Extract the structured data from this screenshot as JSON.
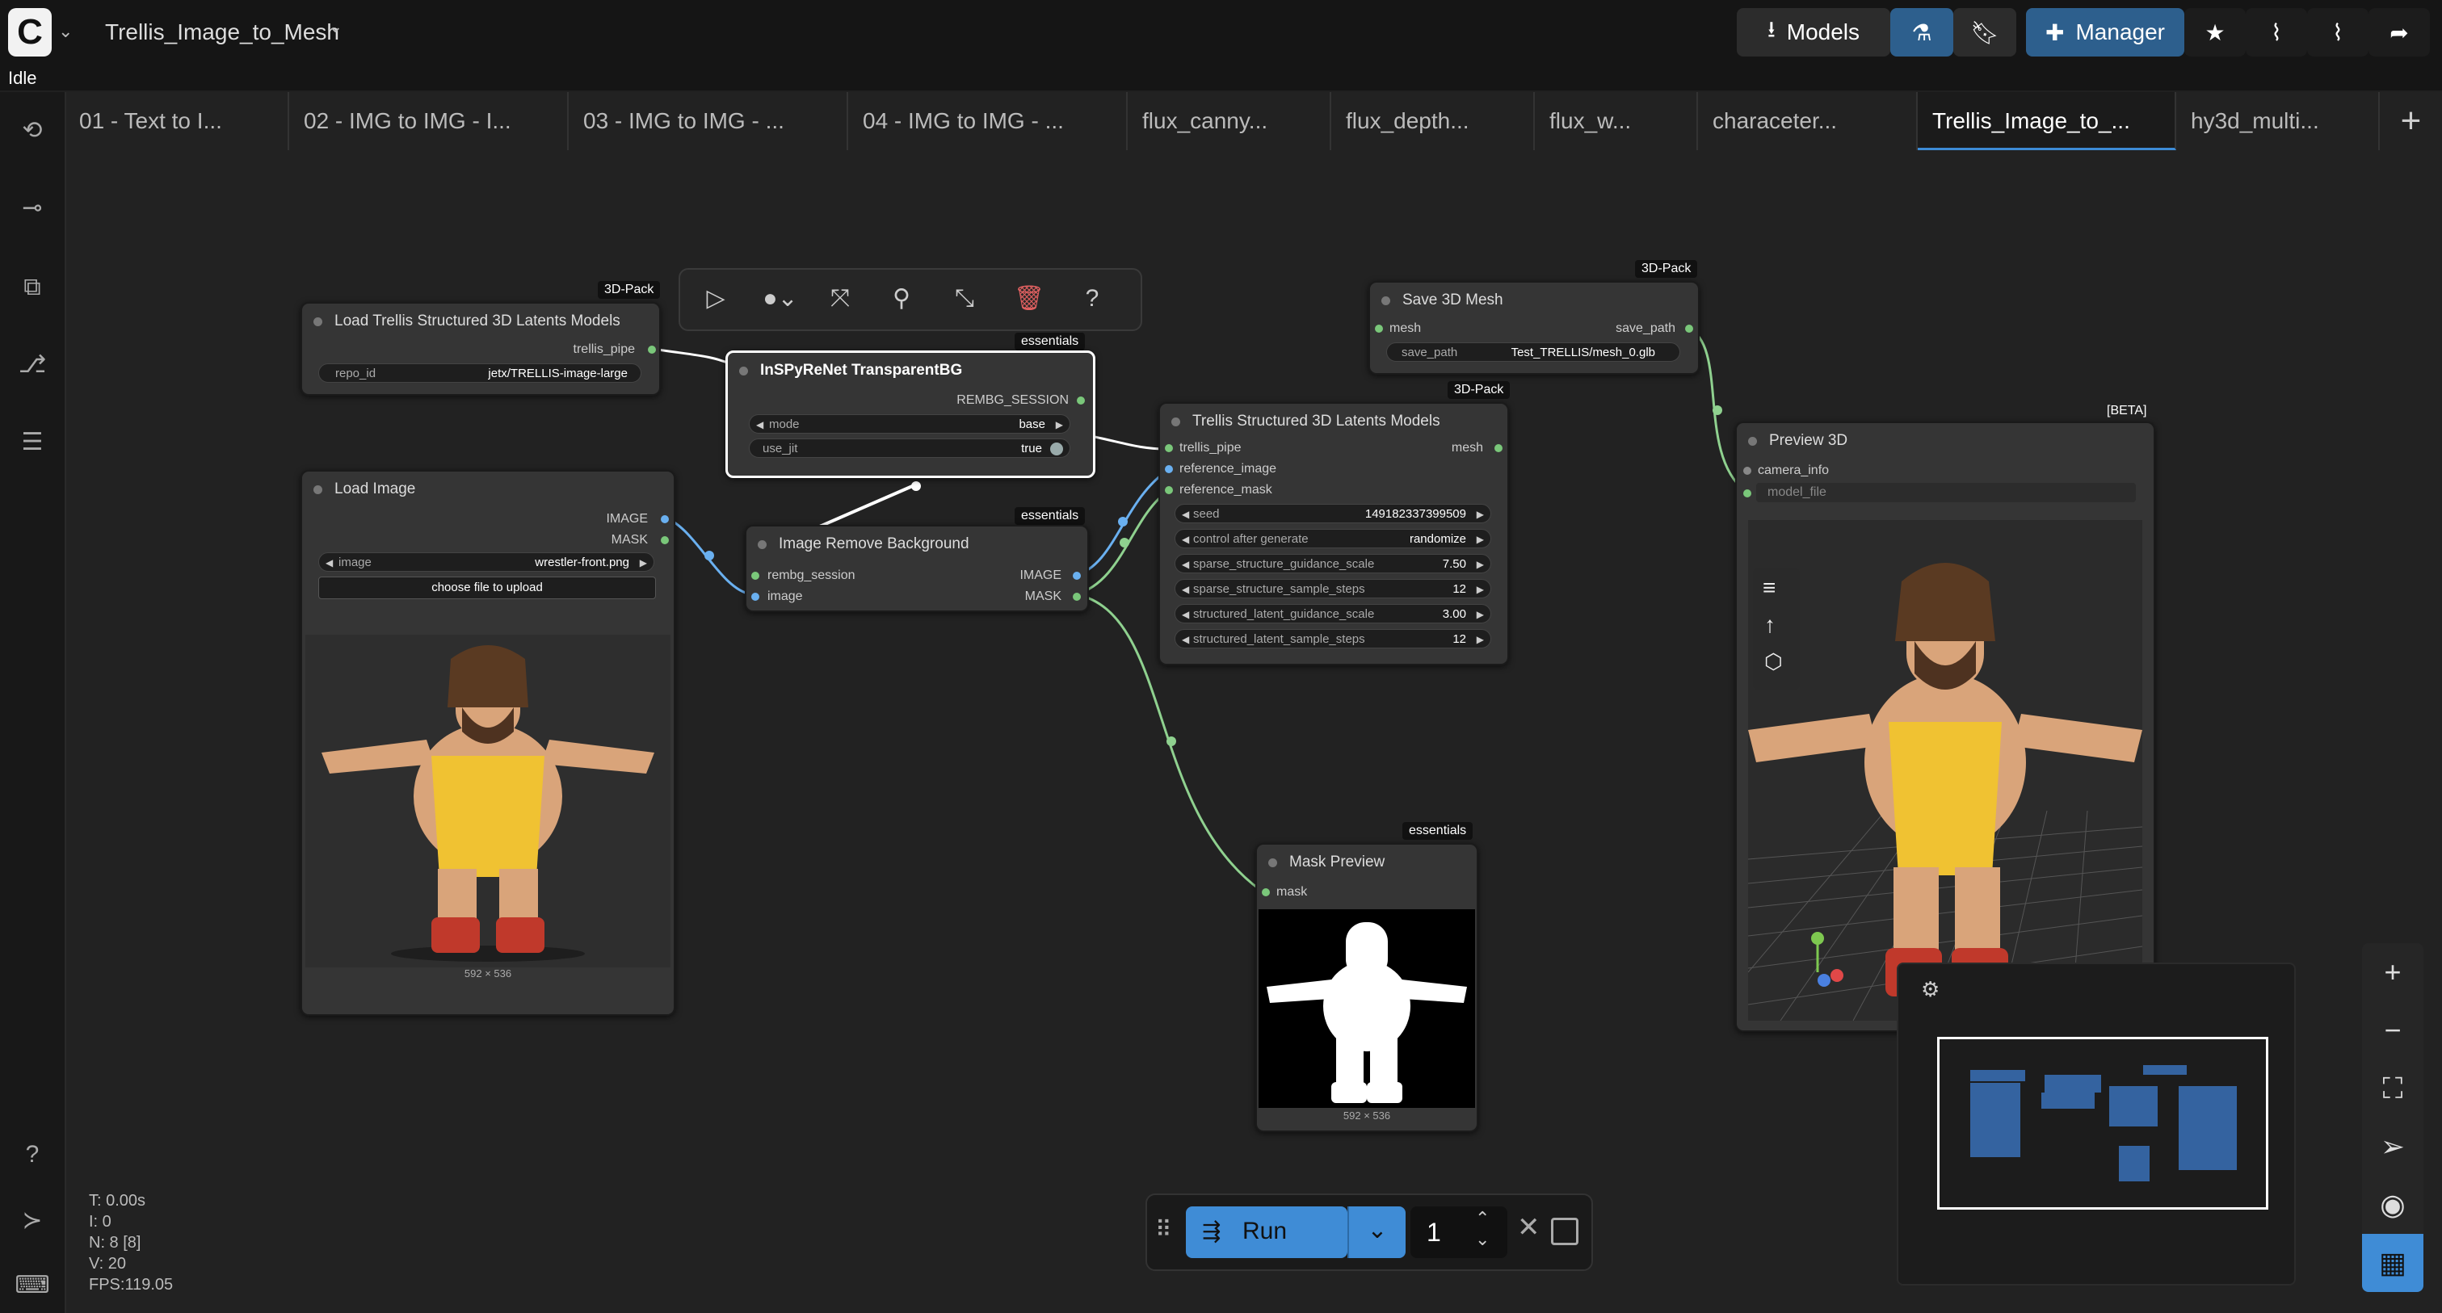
{
  "app": {
    "title": "Trellis_Image_to_Mesh",
    "status": "Idle",
    "logo": "C"
  },
  "topbar": {
    "models_label": "Models",
    "manager_label": "Manager"
  },
  "tabs": [
    {
      "label": "01 - Text to I..."
    },
    {
      "label": "02 - IMG to IMG - I..."
    },
    {
      "label": "03 - IMG to IMG - ..."
    },
    {
      "label": "04 - IMG to IMG - ..."
    },
    {
      "label": "flux_canny..."
    },
    {
      "label": "flux_depth..."
    },
    {
      "label": "flux_w..."
    },
    {
      "label": "characeter..."
    },
    {
      "label": "Trellis_Image_to_..."
    },
    {
      "label": "hy3d_multi..."
    }
  ],
  "nodes": {
    "load_trellis": {
      "tag": "3D-Pack",
      "title": "Load Trellis Structured 3D Latents Models",
      "output": "trellis_pipe",
      "widget_label": "repo_id",
      "widget_value": "jetx/TRELLIS-image-large"
    },
    "inspyrenet": {
      "tag": "essentials",
      "title": "InSPyReNet TransparentBG",
      "output": "REMBG_SESSION",
      "mode_label": "mode",
      "mode_value": "base",
      "jit_label": "use_jit",
      "jit_value": "true"
    },
    "load_image": {
      "title": "Load Image",
      "out_image": "IMAGE",
      "out_mask": "MASK",
      "image_label": "image",
      "image_value": "wrestler-front.png",
      "upload_label": "choose file to upload",
      "image_size": "592 × 536"
    },
    "remove_bg": {
      "tag": "essentials",
      "title": "Image Remove Background",
      "in_session": "rembg_session",
      "in_image": "image",
      "out_image": "IMAGE",
      "out_mask": "MASK"
    },
    "trellis_models": {
      "tag": "3D-Pack",
      "title": "Trellis Structured 3D Latents Models",
      "in_pipe": "trellis_pipe",
      "in_ref_image": "reference_image",
      "in_ref_mask": "reference_mask",
      "out_mesh": "mesh",
      "widgets": [
        {
          "label": "seed",
          "value": "149182337399509"
        },
        {
          "label": "control after generate",
          "value": "randomize"
        },
        {
          "label": "sparse_structure_guidance_scale",
          "value": "7.50"
        },
        {
          "label": "sparse_structure_sample_steps",
          "value": "12"
        },
        {
          "label": "structured_latent_guidance_scale",
          "value": "3.00"
        },
        {
          "label": "structured_latent_sample_steps",
          "value": "12"
        }
      ]
    },
    "save_mesh": {
      "tag": "3D-Pack",
      "title": "Save 3D Mesh",
      "in_mesh": "mesh",
      "out_path": "save_path",
      "widget_label": "save_path",
      "widget_value": "Test_TRELLIS/mesh_0.glb"
    },
    "preview3d": {
      "tag": "[BETA]",
      "title": "Preview 3D",
      "in_camera": "camera_info",
      "in_model": "model_file"
    },
    "mask_preview": {
      "tag": "essentials",
      "title": "Mask Preview",
      "in_mask": "mask",
      "image_size": "592 × 536"
    }
  },
  "runbar": {
    "run_label": "Run",
    "count": "1"
  },
  "stats": {
    "t": "T: 0.00s",
    "i": "I: 0",
    "n": "N: 8 [8]",
    "v": "V: 20",
    "fps": "FPS:119.05"
  },
  "colors": {
    "accent": "#3f8cd6",
    "link_green": "#8fd18f",
    "link_blue": "#6ab0f0",
    "minimap_node": "#3463a0"
  }
}
